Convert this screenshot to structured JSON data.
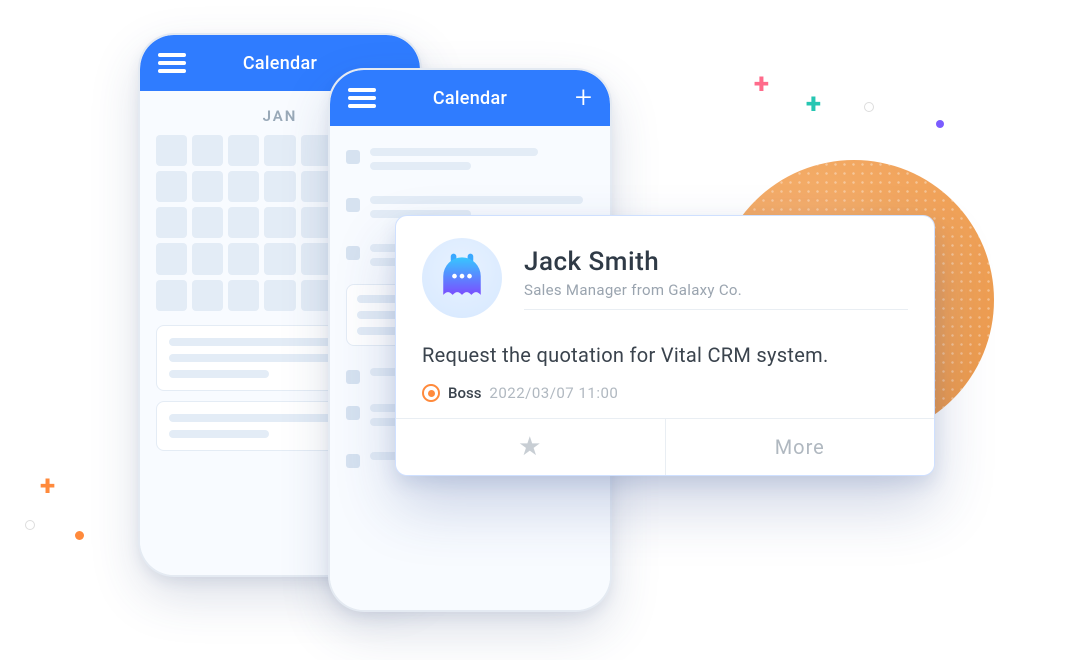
{
  "phone1": {
    "title": "Calendar",
    "month": "JAN"
  },
  "phone2": {
    "title": "Calendar"
  },
  "card": {
    "name": "Jack Smith",
    "role": "Sales Manager from Galaxy Co.",
    "request": "Request the quotation for Vital CRM system.",
    "assigned": "Boss",
    "timestamp": "2022/03/07 11:00",
    "more_label": "More"
  }
}
